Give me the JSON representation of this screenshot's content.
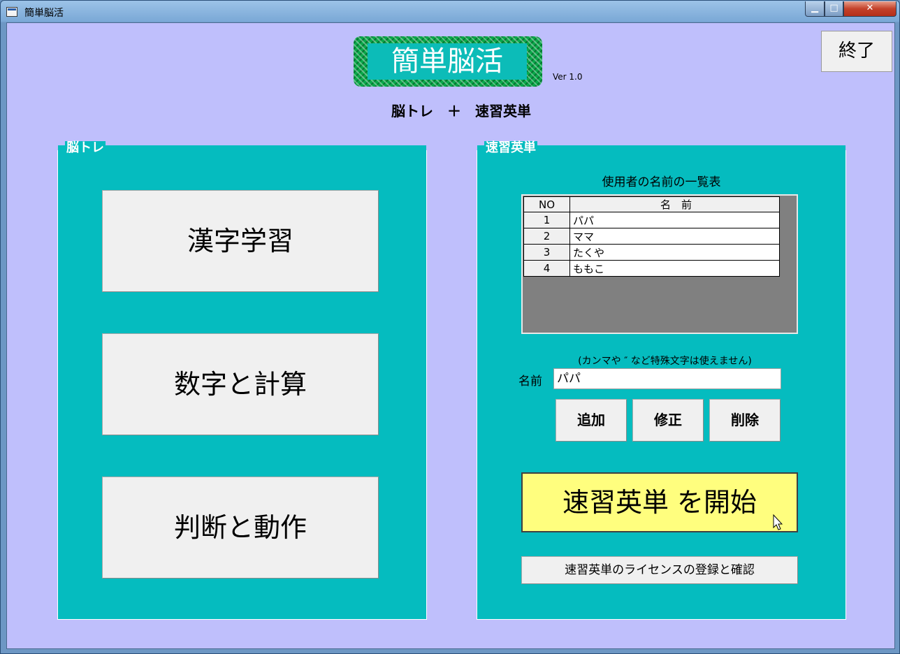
{
  "window": {
    "title": "簡単脳活",
    "controls": {
      "minimize": "▁",
      "maximize": "□",
      "close": "✕"
    }
  },
  "header": {
    "logo_text": "簡単脳活",
    "version": "Ver 1.0",
    "subtitle": "脳トレ　＋　速習英単",
    "exit_label": "終了"
  },
  "brain_training": {
    "group_label": "脳トレ",
    "buttons": [
      "漢字学習",
      "数字と計算",
      "判断と動作"
    ]
  },
  "english": {
    "group_label": "速習英単",
    "list_caption": "使用者の名前の一覧表",
    "columns": {
      "no": "NO",
      "name": "名　前"
    },
    "rows": [
      {
        "no": "1",
        "name": "パパ"
      },
      {
        "no": "2",
        "name": "ママ"
      },
      {
        "no": "3",
        "name": "たくや"
      },
      {
        "no": "4",
        "name": "ももこ"
      }
    ],
    "note": "(カンマや ″ など特殊文字は使えません)",
    "name_label": "名前",
    "name_value": "パパ",
    "add_label": "追加",
    "edit_label": "修正",
    "delete_label": "削除",
    "start_label": "速習英単 を開始",
    "license_label": "速習英単のライセンスの登録と確認"
  },
  "colors": {
    "client_bg": "#bfbffc",
    "group_bg": "#05bcbf",
    "start_button_bg": "#fffe7e",
    "logo_bg": "#0cbcb8"
  }
}
